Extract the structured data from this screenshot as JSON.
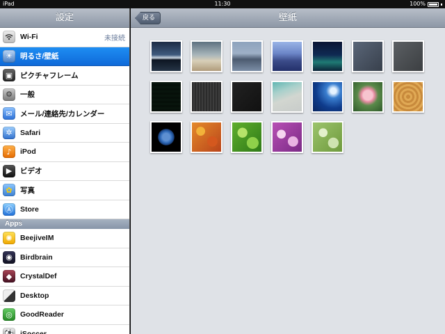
{
  "status": {
    "device": "iPad",
    "time": "11:30",
    "battery": "100%"
  },
  "settings": {
    "title": "設定",
    "rows": [
      {
        "label": "Wi-Fi",
        "value": "未接続",
        "icon": "wifi-icon"
      },
      {
        "label": "明るさ/壁紙",
        "value": "",
        "icon": "brightness-icon"
      },
      {
        "label": "ピクチャフレーム",
        "value": "",
        "icon": "picture-frame-icon"
      },
      {
        "label": "一般",
        "value": "",
        "icon": "gear-icon"
      },
      {
        "label": "メール/連絡先/カレンダー",
        "value": "",
        "icon": "mail-icon"
      },
      {
        "label": "Safari",
        "value": "",
        "icon": "compass-icon"
      },
      {
        "label": "iPod",
        "value": "",
        "icon": "ipod-icon"
      },
      {
        "label": "ビデオ",
        "value": "",
        "icon": "video-icon"
      },
      {
        "label": "写真",
        "value": "",
        "icon": "sunflower-icon"
      },
      {
        "label": "Store",
        "value": "",
        "icon": "app-store-icon"
      }
    ],
    "apps_header": "Apps",
    "apps": [
      {
        "label": "BeejiveIM",
        "icon": "beejive-icon"
      },
      {
        "label": "Birdbrain",
        "icon": "bird-icon"
      },
      {
        "label": "CrystalDef",
        "icon": "crystal-icon"
      },
      {
        "label": "Desktop",
        "icon": "desktop-icon"
      },
      {
        "label": "GoodReader",
        "icon": "eye-icon"
      },
      {
        "label": "iSoccer",
        "icon": "soccer-icon"
      }
    ]
  },
  "detail": {
    "back": "戻る",
    "title": "壁紙",
    "wallpapers": [
      "lake-sunset",
      "mountain-haze",
      "dusk-lake",
      "blue-mountains",
      "aurora",
      "slate-texture",
      "gray-texture",
      "plaid-fabric",
      "dark-stripes",
      "black-texture",
      "sand-ripples",
      "ocean-wave",
      "lotus-flower",
      "wood-rings",
      "earth",
      "autumn-leaves",
      "green-leaves",
      "purple-flowers",
      "pale-green-leaves"
    ]
  }
}
